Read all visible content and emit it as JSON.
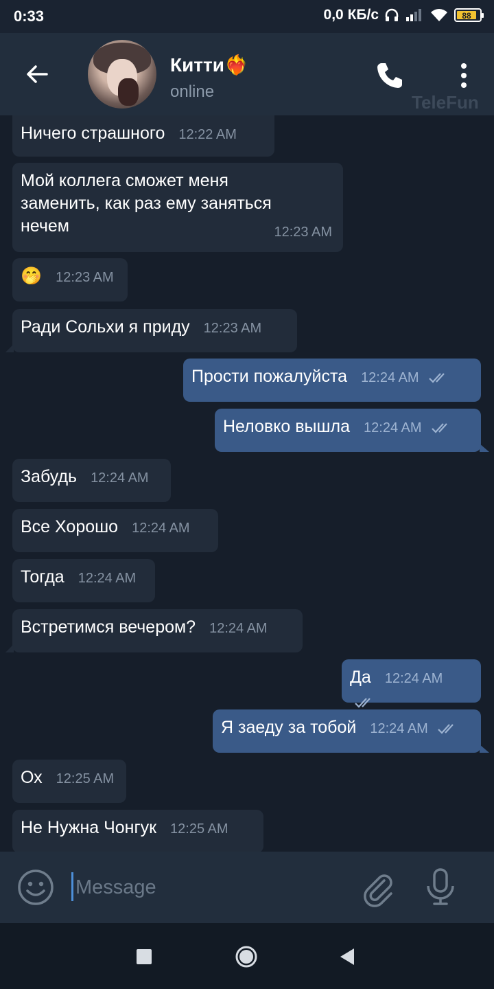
{
  "status_bar": {
    "time": "0:33",
    "network": "0,0 КБ/с",
    "battery": "88"
  },
  "header": {
    "name": "Китти❤️‍🔥",
    "status": "online",
    "watermark": "TeleFun"
  },
  "messages": [
    {
      "dir": "in",
      "text": "Ничего страшного",
      "time": "12:22 AM"
    },
    {
      "dir": "in",
      "text": "Мой коллега сможет меня заменить, как раз ему заняться нечем",
      "lines": [
        "Мой коллега сможет меня",
        "заменить, как раз ему заняться",
        "нечем"
      ],
      "time": "12:23 AM"
    },
    {
      "dir": "in",
      "text": "🤭",
      "time": "12:23 AM"
    },
    {
      "dir": "in",
      "text": "Ради Сольхи я приду",
      "time": "12:23 AM"
    },
    {
      "dir": "out",
      "text": "Прости пожалуйста",
      "time": "12:24 AM"
    },
    {
      "dir": "out",
      "text": "Неловко вышла",
      "time": "12:24 AM"
    },
    {
      "dir": "in",
      "text": "Забудь",
      "time": "12:24 AM"
    },
    {
      "dir": "in",
      "text": "Все Хорошо",
      "time": "12:24 AM"
    },
    {
      "dir": "in",
      "text": "Тогда",
      "time": "12:24 AM"
    },
    {
      "dir": "in",
      "text": "Встретимся вечером?",
      "time": "12:24 AM"
    },
    {
      "dir": "out",
      "text": "Да",
      "time": "12:24 AM"
    },
    {
      "dir": "out",
      "text": "Я заеду за тобой",
      "time": "12:24 AM"
    },
    {
      "dir": "in",
      "text": "Ох",
      "time": "12:25 AM"
    },
    {
      "dir": "in",
      "text": "Не Нужна Чонгук",
      "time": "12:25 AM"
    }
  ],
  "composer": {
    "placeholder": "Message"
  },
  "icons": {
    "back": "arrow-left-icon",
    "call": "phone-icon",
    "menu": "more-vert-icon",
    "emoji": "smile-icon",
    "attach": "paperclip-icon",
    "mic": "microphone-icon",
    "read": "double-check-icon"
  },
  "colors": {
    "background": "#161e2a",
    "incoming": "#222c3a",
    "outgoing": "#3a5a88",
    "accent": "#4d8fd8"
  }
}
